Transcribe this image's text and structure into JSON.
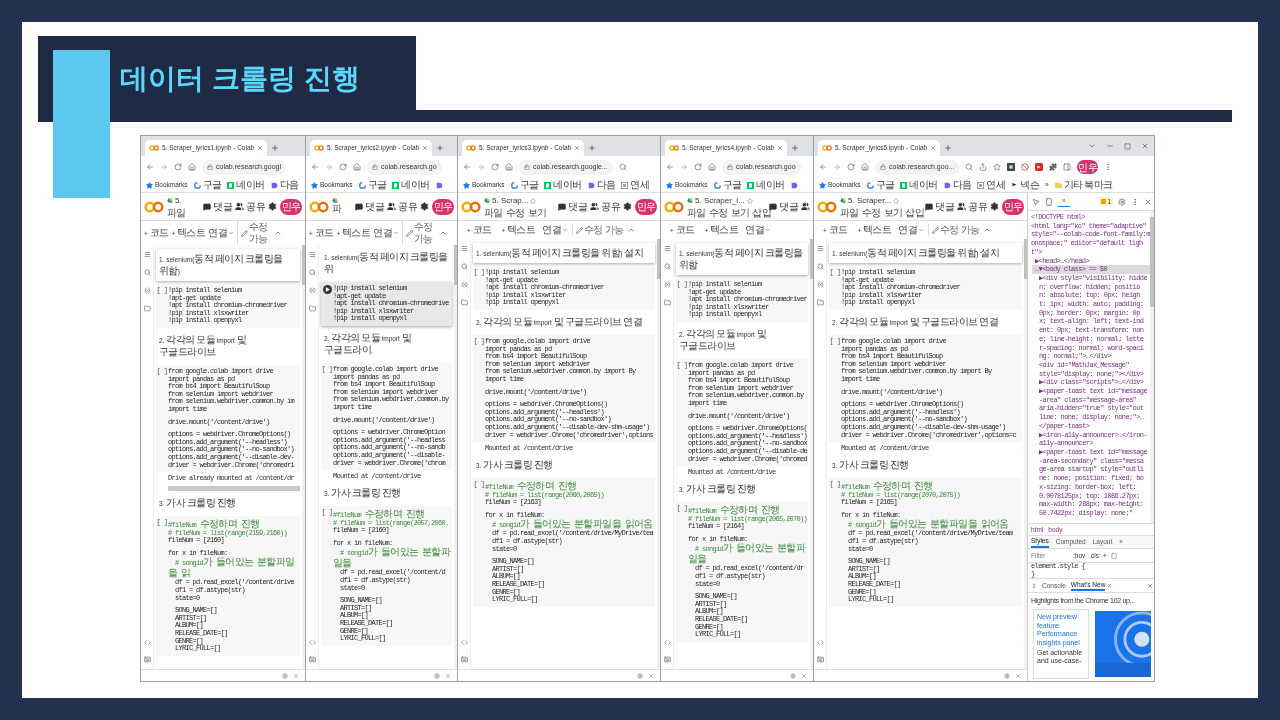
{
  "slide": {
    "title": "데이터 크롤링 진행"
  },
  "windows": [
    {
      "tab": "5. Scraper_lyrics1.ipynb - Colab",
      "url": "colab.research.googl",
      "bookmarks": [
        {
          "kind": "star",
          "label": "Bookmarks"
        },
        {
          "kind": "google",
          "label": "구글"
        },
        {
          "kind": "naver",
          "label": "네이버"
        },
        {
          "kind": "daum",
          "label": "다음"
        }
      ],
      "header": {
        "title": "5.",
        "menu": [
          "파일"
        ],
        "actions": [
          {
            "kind": "comment",
            "label": "댓글"
          },
          {
            "kind": "share",
            "label": "공유"
          },
          {
            "kind": "settings"
          },
          {
            "kind": "avatar",
            "label": "민우"
          }
        ]
      },
      "toolbar": [
        {
          "kind": "add",
          "label": "+ 코드"
        },
        {
          "kind": "add",
          "label": "+ 텍스트"
        },
        {
          "kind": "connect",
          "label": "연결"
        },
        {
          "kind": "edit",
          "label": "수정 가능"
        },
        {
          "kind": "collapse"
        }
      ],
      "cells": [
        {
          "kind": "text",
          "selected": true,
          "text": "1. selenium(동적 페이지 크롤링을 위함)"
        },
        {
          "kind": "code",
          "selected": false,
          "running": false,
          "prompt": "[ ]",
          "blocks": [
            [
              "!pip install selenium",
              "!apt-get update",
              "!apt install chromium-chromedriver",
              "!pip install xlsxwriter",
              "!pip install openpyxl"
            ]
          ]
        },
        {
          "kind": "text",
          "selected": false,
          "text": "2. 각각의 모듈 import 및 구글드라이브"
        },
        {
          "kind": "code",
          "selected": false,
          "running": false,
          "prompt": "[ ]",
          "blocks": [
            [
              "from google.colab import drive",
              "import pandas as pd",
              "from bs4 import BeautifulSoup",
              "from selenium import webdriver",
              "from selenium.webdriver.common.by im",
              "import time"
            ],
            [
              "drive.mount('/content/drive')"
            ],
            [
              "options = webdriver.ChromeOptions()",
              "options.add_argument('--headless')",
              "options.add_argument('--no-sandbox')",
              "options.add_argument('--disable-dev-",
              "driver = webdriver.Chrome('chromedri"
            ]
          ]
        },
        {
          "kind": "output",
          "text": "Drive already mounted at /content/dr",
          "scrollbar": true
        },
        {
          "kind": "text",
          "selected": false,
          "text": "3. 가사 크롤링 진행"
        },
        {
          "kind": "code",
          "selected": false,
          "running": false,
          "prompt": "[ ]",
          "blocks": [
            [
              {
                "text": "#fileNum 수정하며 진행",
                "kind": "comment"
              },
              {
                "text": "# fileNum = list(range(2159,2160))",
                "kind": "comment"
              },
              "fileNum = [2160]"
            ],
            [
              "for x in fileNum:",
              {
                "text": "  # songid가 들어있는 분할파일을 읽",
                "kind": "comment"
              },
              "  df = pd.read_excel('/content/drive",
              "  df1 = df.astype(str)",
              "  state=0"
            ],
            [
              "  SONG_NAME=[]",
              "  ARTIST=[]",
              "  ALBUM=[]",
              "  RELEASE_DATE=[]",
              "  GENRE=[]",
              "  LYRIC_FULL=[]"
            ]
          ]
        }
      ]
    },
    {
      "tab": "5. Scraper_lyrics2.ipynb - Colab",
      "url": "colab.research.go",
      "bookmarks": [
        {
          "kind": "star",
          "label": "Bookmarks"
        },
        {
          "kind": "google",
          "label": "구글"
        },
        {
          "kind": "naver",
          "label": "네이버"
        },
        {
          "kind": "daum"
        }
      ],
      "header": {
        "menu": [
          "파"
        ],
        "actions": [
          {
            "kind": "comment",
            "label": "댓글"
          },
          {
            "kind": "share",
            "label": "공유"
          },
          {
            "kind": "settings"
          },
          {
            "kind": "avatar",
            "label": "민우"
          }
        ]
      },
      "toolbar": [
        {
          "kind": "add",
          "label": "+ 코드"
        },
        {
          "kind": "add",
          "label": "+ 텍스트"
        },
        {
          "kind": "connect",
          "label": "연결"
        },
        {
          "kind": "edit",
          "label": "수정 가능"
        },
        {
          "kind": "collapse"
        }
      ],
      "cells": [
        {
          "kind": "text",
          "selected": false,
          "text": "1. selenium(동적 페이지 크롤링을 위"
        },
        {
          "kind": "code",
          "selected": true,
          "running": true,
          "blocks": [
            [
              "!pip install selenium",
              "!apt-get update",
              "!apt install chromium-chromedrive",
              "!pip install xlsxwriter",
              "!pip install openpyxl"
            ]
          ]
        },
        {
          "kind": "text",
          "selected": false,
          "text": "2. 각각의 모듈 import 및 구글드라이."
        },
        {
          "kind": "code",
          "selected": false,
          "running": false,
          "prompt": "[ ]",
          "blocks": [
            [
              "from google.colab import drive",
              "import pandas as pd",
              "from bs4 import BeautifulSoup",
              "from selenium import webdriver",
              "from selenium.webdriver.common.by",
              "import time"
            ],
            [
              "drive.mount('/content/drive')"
            ],
            [
              "options = webdriver.ChromeOption",
              "options.add_argument('--headless",
              "options.add_argument('--no-sandb",
              "options.add_argument('--disable-",
              "driver = webdriver.Chrome('chrom"
            ]
          ]
        },
        {
          "kind": "output",
          "text": "Mounted at /content/drive"
        },
        {
          "kind": "text",
          "selected": false,
          "text": "3. 가사 크롤링 진행"
        },
        {
          "kind": "code",
          "selected": false,
          "running": false,
          "prompt": "[ ]",
          "blocks": [
            [
              {
                "text": "#fileNum 수정하며 진행",
                "kind": "comment"
              },
              {
                "text": "# fileNum = list(range(2057,2060.",
                "kind": "comment"
              },
              "fileNum = [2160]"
            ],
            [
              "for x in fileNum:",
              {
                "text": "  # songid가 들어있는 분할파일을",
                "kind": "comment"
              },
              "  df = pd.read_excel('/content/d",
              "  df1 = df.astype(str)",
              "  state=0"
            ],
            [
              "  SONG_NAME=[]",
              "  ARTIST=[]",
              "  ALBUM=[]",
              "  RELEASE_DATE=[]",
              "  GENRE=[]",
              "  LYRIC_FULL=[]"
            ]
          ]
        }
      ]
    },
    {
      "tab": "5. Scraper_lyrics3.ipynb - Colab",
      "url": "colab.research.google...",
      "address_icons": [
        {
          "kind": "search"
        }
      ],
      "bookmarks": [
        {
          "kind": "star",
          "label": "Bookmarks"
        },
        {
          "kind": "google",
          "label": "구글"
        },
        {
          "kind": "naver",
          "label": "네이버"
        },
        {
          "kind": "daum",
          "label": "다음"
        },
        {
          "kind": "grid",
          "label": "연세"
        }
      ],
      "header": {
        "title": "5. Scrap...",
        "star": true,
        "menu": [
          "파일",
          "수정",
          "보기"
        ],
        "actions": [
          {
            "kind": "comment",
            "label": "댓글"
          },
          {
            "kind": "share",
            "label": "공유"
          },
          {
            "kind": "settings"
          },
          {
            "kind": "avatar",
            "label": "민우"
          }
        ]
      },
      "toolbar": [
        {
          "kind": "add",
          "label": "+ 코드"
        },
        {
          "kind": "add",
          "label": "+ 텍스트"
        },
        {
          "kind": "connect",
          "label": "연결"
        },
        {
          "kind": "edit",
          "label": "수정 가능"
        },
        {
          "kind": "collapse"
        }
      ],
      "cells": [
        {
          "kind": "text",
          "selected": true,
          "text": "1. selenium(동적 페이지 크롤링을 위함) 설치"
        },
        {
          "kind": "code",
          "selected": false,
          "running": false,
          "prompt": "[ ]",
          "blocks": [
            [
              "!pip install selenium",
              "!apt-get update",
              "!apt install chromium-chromedriver",
              "!pip install xlsxwriter",
              "!pip install openpyxl"
            ]
          ]
        },
        {
          "kind": "text",
          "selected": false,
          "text": "2. 각각의 모듈 import 및 구글드라이브 연결"
        },
        {
          "kind": "code",
          "selected": false,
          "running": false,
          "prompt": "[ ]",
          "blocks": [
            [
              "from google.colab import drive",
              "import pandas as pd",
              "from bs4 import BeautifulSoup",
              "from selenium import webdriver",
              "from selenium.webdriver.common.by import By",
              "import time"
            ],
            [
              "drive.mount('/content/drive')"
            ],
            [
              "options = webdriver.ChromeOptions()",
              "options.add_argument('--headless')",
              "options.add_argument('--no-sandbox')",
              "options.add_argument('--disable-dev-shm-usage')",
              "driver = webdriver.Chrome('chromedriver',options"
            ]
          ]
        },
        {
          "kind": "output",
          "text": "Mounted at /content/drive"
        },
        {
          "kind": "text",
          "selected": false,
          "text": "3. 가사 크롤링 진행"
        },
        {
          "kind": "code",
          "selected": false,
          "running": false,
          "prompt": "[ ]",
          "blocks": [
            [
              {
                "text": "#fileNum 수정하며 진행",
                "kind": "comment"
              },
              {
                "text": "# fileNum = list(range(2060,2065))",
                "kind": "comment"
              },
              "fileNum = [2163]"
            ],
            [
              "for x in fileNum:",
              {
                "text": "  # songid가 들어있는 분할파일을 읽어옴",
                "kind": "comment"
              },
              "  df = pd.read_excel('/content/drive/MyDrive/tea",
              "  df1 = df.astype(str)",
              "  state=0"
            ],
            [
              "  SONG_NAME=[]",
              "  ARTIST=[]",
              "  ALBUM=[]",
              "  RELEASE_DATE=[]",
              "  GENRE=[]",
              "  LYRIC_FULL=[]"
            ]
          ]
        }
      ]
    },
    {
      "tab": "5. Scraper_lyrics4.ipynb - Colab",
      "url": "colab.research.goo",
      "bookmarks": [
        {
          "kind": "star",
          "label": "Bookmarks"
        },
        {
          "kind": "google",
          "label": "구글"
        },
        {
          "kind": "naver",
          "label": "네이버"
        },
        {
          "kind": "daum"
        }
      ],
      "header": {
        "title": "5. Scraper_l...",
        "star": true,
        "menu": [
          "파일",
          "수정",
          "보기",
          "삽입"
        ],
        "actions": [
          {
            "kind": "comment",
            "label": "댓글"
          },
          {
            "kind": "share"
          }
        ]
      },
      "toolbar": [
        {
          "kind": "add",
          "label": "+ 코드"
        },
        {
          "kind": "add",
          "label": "+ 텍스트"
        },
        {
          "kind": "connect",
          "label": "연결"
        }
      ],
      "cells": [
        {
          "kind": "text",
          "selected": true,
          "text": "1. selenium(동적 페이지 크롤링을 위함"
        },
        {
          "kind": "code",
          "selected": false,
          "running": false,
          "prompt": "[ ]",
          "blocks": [
            [
              "!pip install selenium",
              "!apt-get update",
              "!apt install chromium-chromedriver",
              "!pip install xlsxwriter",
              "!pip install openpyxl"
            ]
          ]
        },
        {
          "kind": "text",
          "selected": false,
          "text": "2. 각각의 모듈 import 및 구글드라이브"
        },
        {
          "kind": "code",
          "selected": false,
          "running": false,
          "prompt": "[ ]",
          "blocks": [
            [
              "from google.colab import drive",
              "import pandas as pd",
              "from bs4 import BeautifulSoup",
              "from selenium import webdriver",
              "from selenium.webdriver.common.by",
              "import time"
            ],
            [
              "drive.mount('/content/drive')"
            ],
            [
              "options = webdriver.ChromeOptions(",
              "options.add_argument('--headless')",
              "options.add_argument('--no-sandbox",
              "options.add_argument('--disable-de",
              "driver = webdriver.Chrome('chromed"
            ]
          ]
        },
        {
          "kind": "output",
          "text": "Mounted at /content/drive"
        },
        {
          "kind": "text",
          "selected": false,
          "text": "3. 가사 크롤링 진행"
        },
        {
          "kind": "code",
          "selected": false,
          "running": false,
          "prompt": "[ ]",
          "blocks": [
            [
              {
                "text": "#fileNum 수정하며 진행",
                "kind": "comment"
              },
              {
                "text": "# fileNum = list(range(2065,2070))",
                "kind": "comment"
              },
              "fileNum = [2164]"
            ],
            [
              "for x in fileNum:",
              {
                "text": "  # songid가 들어있는 분할파일을",
                "kind": "comment"
              },
              "  df = pd.read_excel('/content/dr",
              "  df1 = df.astype(str)",
              "  state=0"
            ],
            [
              "  SONG_NAME=[]",
              "  ARTIST=[]",
              "  ALBUM=[]",
              "  RELEASE_DATE=[]",
              "  GENRE=[]",
              "  LYRIC_FULL=[]"
            ]
          ]
        }
      ]
    },
    {
      "tab": "5. Scraper_lyrics5.ipynb - Colab",
      "url": "colab.research.goo...",
      "window_controls": true,
      "address_icons": [
        {
          "kind": "search"
        },
        {
          "kind": "share"
        },
        {
          "kind": "star"
        },
        {
          "kind": "ext-dark"
        },
        {
          "kind": "ext-block"
        },
        {
          "kind": "ext-red"
        },
        {
          "kind": "puzzle"
        },
        {
          "kind": "panel"
        },
        {
          "kind": "avatar"
        },
        {
          "kind": "menu"
        }
      ],
      "address_avatar": "민우",
      "bookmarks": [
        {
          "kind": "star",
          "label": "Bookmarks"
        },
        {
          "kind": "google",
          "label": "구글"
        },
        {
          "kind": "naver",
          "label": "네이버"
        },
        {
          "kind": "daum",
          "label": "다음"
        },
        {
          "kind": "grid",
          "label": "연세"
        },
        {
          "kind": "nexon",
          "label": "넥슨"
        },
        {
          "kind": "more",
          "label": "»"
        },
        {
          "kind": "folder",
          "label": "기타 북마크"
        }
      ],
      "header": {
        "title": "5. Scraper...",
        "star": true,
        "menu": [
          "파일",
          "수정",
          "보기",
          "삽입"
        ],
        "actions": [
          {
            "kind": "comment",
            "label": "댓글"
          },
          {
            "kind": "share",
            "label": "공유"
          },
          {
            "kind": "settings"
          },
          {
            "kind": "avatar",
            "label": "민우"
          }
        ]
      },
      "toolbar": [
        {
          "kind": "add",
          "label": "+ 코드"
        },
        {
          "kind": "add",
          "label": "+ 텍스트"
        },
        {
          "kind": "connect",
          "label": "연결"
        },
        {
          "kind": "edit",
          "label": "수정 가능"
        },
        {
          "kind": "collapse"
        }
      ],
      "cells": [
        {
          "kind": "text",
          "selected": true,
          "text": "1. selenium(동적 페이지 크롤링을 위함) 설치"
        },
        {
          "kind": "code",
          "selected": false,
          "running": false,
          "prompt": "[ ]",
          "blocks": [
            [
              "!pip install selenium",
              "!apt-get update",
              "!apt install chromium-chromedriver",
              "!pip install xlsxwriter",
              "!pip install openpyxl"
            ]
          ]
        },
        {
          "kind": "text",
          "selected": false,
          "text": "2. 각각의 모듈 import 및 구글드라이브 연결"
        },
        {
          "kind": "code",
          "selected": false,
          "running": false,
          "prompt": "[ ]",
          "blocks": [
            [
              "from google.colab import drive",
              "import pandas as pd",
              "from bs4 import BeautifulSoup",
              "from selenium import webdriver",
              "from selenium.webdriver.common.by import By",
              "import time"
            ],
            [
              "drive.mount('/content/drive')"
            ],
            [
              "options = webdriver.ChromeOptions()",
              "options.add_argument('--headless')",
              "options.add_argument('--no-sandbox')",
              "options.add_argument('--disable-dev-shm-usage')",
              "driver = webdriver.Chrome('chromedriver',options=c"
            ]
          ]
        },
        {
          "kind": "output",
          "text": "Mounted at /content/drive"
        },
        {
          "kind": "text",
          "selected": false,
          "text": "3. 가사 크롤링 진행"
        },
        {
          "kind": "code",
          "selected": false,
          "running": false,
          "prompt": "[ ]",
          "blocks": [
            [
              {
                "text": "#fileNum 수정하며 진행",
                "kind": "comment"
              },
              {
                "text": "# fileNum = list(range(2070,2075))",
                "kind": "comment"
              },
              "fileNum = [2165]"
            ],
            [
              "for x in fileNum:",
              {
                "text": "  # songid가 들어있는 분할파일을 읽어옴",
                "kind": "comment"
              },
              "  df = pd.read_excel('/content/drive/MyDrive/team",
              "  df1 = df.astype(str)",
              "  state=0"
            ],
            [
              "  SONG_NAME=[]",
              "  ARTIST=[]",
              "  ALBUM=[]",
              "  RELEASE_DATE=[]",
              "  GENRE=[]",
              "  LYRIC_FULL=[]"
            ]
          ]
        }
      ],
      "devtools": {
        "more": "»",
        "issues": "1",
        "dom": [
          {
            "lines": [
              "<!DOCTYPE html>"
            ],
            "selected": false
          },
          {
            "lines": [
              "<html lang=\"ko\" theme=\"adaptive\"",
              "style=\"--colab-code-font-family:m",
              "onospace;\" editor=\"default ligh",
              "t\">"
            ],
            "selected": false,
            "children": [
              {
                "lines": [
                  "▶<head>…</head>"
                ],
                "selected": false
              },
              {
                "lines": [
                  "…▼<body class> == $0"
                ],
                "selected": true,
                "children": [
                  {
                    "lines": [
                      "▶<div style=\"visibility: hidde",
                      "n; overflow: hidden; positio",
                      "n: absolute; top: 0px; heigh",
                      "t: 1px; width: auto; padding:",
                      "0px; border: 0px; margin: 0p",
                      "x; text-align: left; text-ind",
                      "ent: 0px; text-transform: non",
                      "e; line-height: normal; lette",
                      "r-spacing: normal; word-spaci",
                      "ng: normal;\">…</div>"
                    ],
                    "selected": false
                  },
                  {
                    "lines": [
                      "<div id=\"MathJax_Message\"",
                      "style=\"display: none;\"></div>"
                    ],
                    "selected": false
                  },
                  {
                    "lines": [
                      "▶<div class=\"scripts\">…</div>"
                    ],
                    "selected": false
                  },
                  {
                    "lines": [
                      "▶<paper-toast text id=\"message",
                      "-area\" class=\"message-area\"",
                      "aria-hidden=\"true\" style=\"out",
                      "line: none; display: none;\">…",
                      "</paper-toast>"
                    ],
                    "selected": false
                  },
                  {
                    "lines": [
                      "▶<iron-a11y-announcer>…</iron-",
                      "a11y-announcer>"
                    ],
                    "selected": false
                  },
                  {
                    "lines": [
                      "▶<paper-toast text id=\"message",
                      "-area-secondary\" class=\"messa",
                      "ge-area startup\" style=\"outli",
                      "ne: none; position: fixed; bo",
                      "x-sizing: border-box; left:",
                      "0.0078125px; top: 1086.27px;",
                      "max-width: 288px; max-height:",
                      "50.7422px; display: none;\""
                    ],
                    "selected": false
                  }
                ]
              }
            ]
          }
        ],
        "breadcrumbs": [
          "html",
          "body"
        ],
        "style_tabs": [
          {
            "label": "Styles",
            "selected": true
          },
          {
            "label": "Computed",
            "selected": false
          },
          {
            "label": "Layout",
            "selected": false
          }
        ],
        "filter_placeholder": "Filter",
        "filter_buttons": [
          ":hov",
          ".cls",
          "+"
        ],
        "style_rule": [
          "element.style {",
          "}"
        ],
        "drawer_tabs": [
          {
            "label": "Console",
            "selected": false
          },
          {
            "label": "What's New",
            "selected": true
          }
        ],
        "news_heading": "Highlights from the Chrome 102 up...",
        "card": {
          "link": "New preview feature: Performance insights panel",
          "text": "Get actionable and use-case-"
        }
      }
    }
  ]
}
